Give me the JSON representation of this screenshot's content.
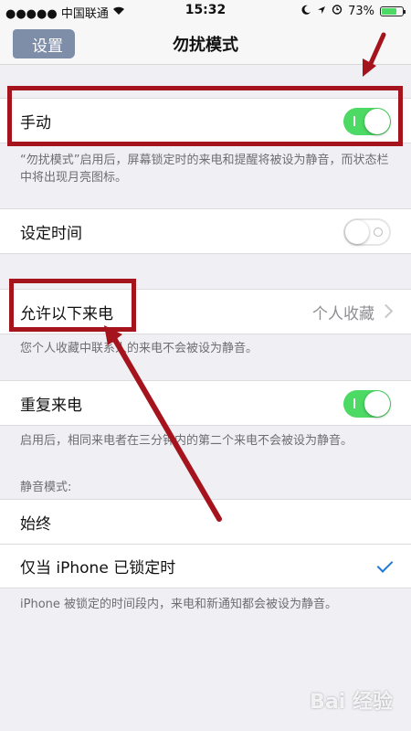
{
  "status_bar": {
    "carrier": "●●●●● 中国联通",
    "time": "15:32",
    "battery": "73%",
    "battery_level": 0.73
  },
  "nav": {
    "back_label": "设置",
    "title": "勿扰模式"
  },
  "manual": {
    "label": "手动",
    "switch_on": true,
    "footer": "“勿扰模式”启用后，屏幕锁定时的来电和提醒将被设为静音，而状态栏中将出现月亮图标。"
  },
  "scheduled": {
    "label": "设定时间",
    "switch_on": false
  },
  "allow_calls": {
    "label": "允许以下来电",
    "value": "个人收藏",
    "footer": "您个人收藏中联系人的来电不会被设为静音。"
  },
  "repeated_calls": {
    "label": "重复来电",
    "switch_on": true,
    "footer": "启用后，相同来电者在三分钟内的第二个来电不会被设为静音。"
  },
  "silence": {
    "header": "静音模式:",
    "options": [
      "始终",
      "仅当 iPhone 已锁定时"
    ],
    "selected_index": 1,
    "footer": "iPhone 被锁定的时间段内，来电和新通知都会被设为静音。"
  },
  "annotation_color": "#a5131c",
  "watermark": "Bai 经验"
}
